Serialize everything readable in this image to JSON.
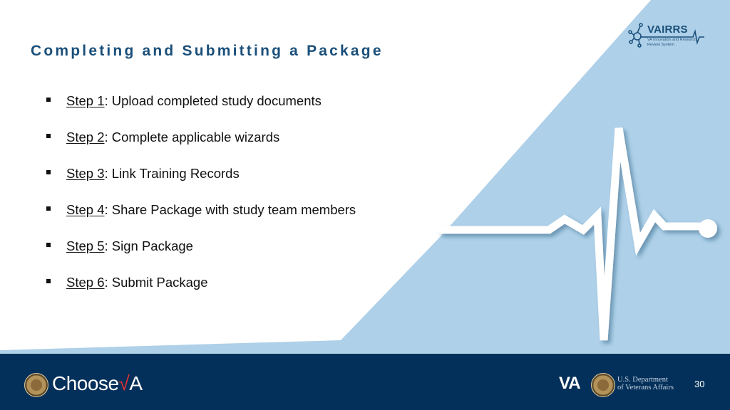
{
  "slide": {
    "title": "Completing and Submitting a Package",
    "page_number": "30",
    "colors": {
      "title": "#1a4f7a",
      "light_blue": "#aed0e8",
      "footer": "#03305a",
      "accent_red": "#e0312f"
    }
  },
  "steps": [
    {
      "label": "Step 1",
      "text": ": Upload completed study documents"
    },
    {
      "label": "Step 2",
      "text": ": Complete applicable wizards"
    },
    {
      "label": "Step 3",
      "text": ": Link Training Records"
    },
    {
      "label": "Step 4",
      "text": ": Share Package with study team members"
    },
    {
      "label": "Step 5",
      "text": ": Sign Package"
    },
    {
      "label": "Step 6",
      "text": ": Submit Package"
    }
  ],
  "header_logo": {
    "name": "VAIRRS",
    "subtitle": "VA Innovation and Research Review System",
    "icon": "network-heartbeat-icon"
  },
  "footer": {
    "choose_prefix": "Choose",
    "choose_check": "√",
    "choose_suffix": "A",
    "va_mark": "VA",
    "dept_line1": "U.S. Department",
    "dept_line2": "of Veterans Affairs",
    "seal_icon": "va-seal-icon"
  },
  "decoration": {
    "icon": "heartbeat-line-icon"
  }
}
